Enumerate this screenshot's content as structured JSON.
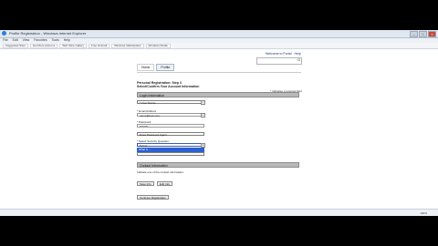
{
  "window": {
    "title": "Profile Registration - Windows Internet Explorer"
  },
  "menu": [
    "File",
    "Edit",
    "View",
    "Favorites",
    "Tools",
    "Help"
  ],
  "favorites": [
    "Suggested Sites",
    "Get More Add-ons",
    "Web Slice Gallery",
    "Free Hotmail",
    "Windows Marketplace",
    "Windows Media"
  ],
  "top_links": {
    "welcome": "Welcome to Portal",
    "help": "Help"
  },
  "search": {
    "placeholder": "",
    "go_label": "G"
  },
  "tabs": [
    {
      "label": "Home"
    },
    {
      "label": "Profile"
    }
  ],
  "headings": {
    "title": "Personal Registration: Step 3",
    "subtitle": "Select/Confirm Your Account Information",
    "required": "* Indicates a required field"
  },
  "sections": {
    "login": "Login Information",
    "contact": "Contact Information"
  },
  "fields": {
    "user_name_label": "* User Name:",
    "email_label": "* Email Address",
    "email_value": "name@test.com",
    "password_label": "* Password:",
    "password_value": "********",
    "confirm_label": "Enter Password Again:",
    "question_label": "* Select Security Question:",
    "question_value": "Select",
    "dropdown_option": "What is ...",
    "contact_note": "Indicate one of the contact information."
  },
  "buttons": {
    "save": "Save Info",
    "edit": "Edit Info",
    "continue": "Continue Registration"
  },
  "status": {
    "zoom": "100%"
  }
}
